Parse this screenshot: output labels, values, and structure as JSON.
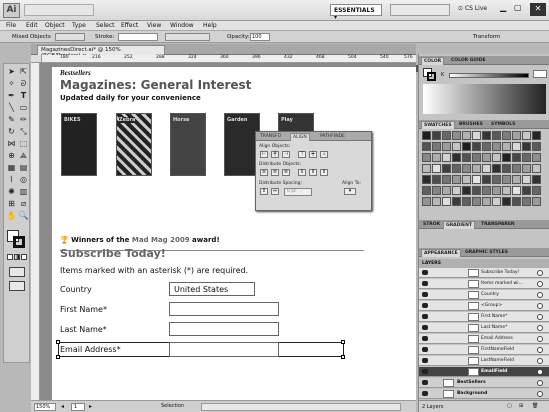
{
  "menubar": {
    "logo": "Ai",
    "menus": [
      "File",
      "Edit",
      "Object",
      "Type",
      "Select",
      "Effect",
      "View",
      "Window",
      "Help"
    ],
    "workspace": "ESSENTIALS",
    "cslive": "CS Live"
  },
  "control_bar": {
    "selection_label": "Mixed Objects",
    "stroke_label": "Stroke:",
    "opacity_label": "Opacity:",
    "opacity_value": "100",
    "transform_label": "Transform"
  },
  "document": {
    "tab_title": "MagazinesDirect.ai* @ 150% (RGB/Preview)",
    "ruler_marks": [
      "180",
      "216",
      "252",
      "288",
      "324",
      "360",
      "396",
      "432",
      "468",
      "504",
      "540",
      "576"
    ]
  },
  "artboard": {
    "kicker": "Bestsellers",
    "headline": "Magazines: General Interest",
    "subhead": "Updated daily for your convenience",
    "award_prefix": "Winners of the ",
    "award_highlight": "Mad Mag 2009",
    "award_suffix": " award!",
    "subscribe_title": "Subscribe Today!",
    "required_note": "Items marked with an asterisk (*) are required.",
    "form": [
      {
        "label": "Country",
        "value": "United States"
      },
      {
        "label": "First Name*",
        "value": ""
      },
      {
        "label": "Last Name*",
        "value": ""
      },
      {
        "label": "Email Address*",
        "value": ""
      }
    ]
  },
  "align_panel": {
    "tabs": [
      "TRANSFO",
      "ALIGN",
      "PATHFINDE"
    ],
    "active_tab": "ALIGN",
    "align_objects": "Align Objects:",
    "distribute_objects": "Distribute Objects:",
    "distribute_spacing": "Distribute Spacing:",
    "align_to": "Align To:",
    "spacing_value": "0 pt"
  },
  "status": {
    "zoom": "150%",
    "page": "1",
    "tool": "Selection"
  },
  "right_panels": {
    "color_tabs": [
      "COLOR",
      "COLOR GUIDE"
    ],
    "color_k_label": "K",
    "swatch_tabs": [
      "SWATCHES",
      "BRUSHES",
      "SYMBOLS"
    ],
    "stroke_tabs": [
      "STROK",
      "GRADIENT",
      "TRANSPAREN"
    ],
    "appearance_tabs": [
      "APPEARANCE",
      "GRAPHIC STYLES"
    ],
    "layers_title": "LAYERS",
    "layers": [
      "Subscribe Today!",
      "Items marked wi...",
      "Country",
      "<Group>",
      "First Name*",
      "Last Name*",
      "Email Address",
      "FirstNameField",
      "LastNameField",
      "EmailField",
      "BestSellers",
      "Background"
    ],
    "layers_count": "2 Layers"
  }
}
